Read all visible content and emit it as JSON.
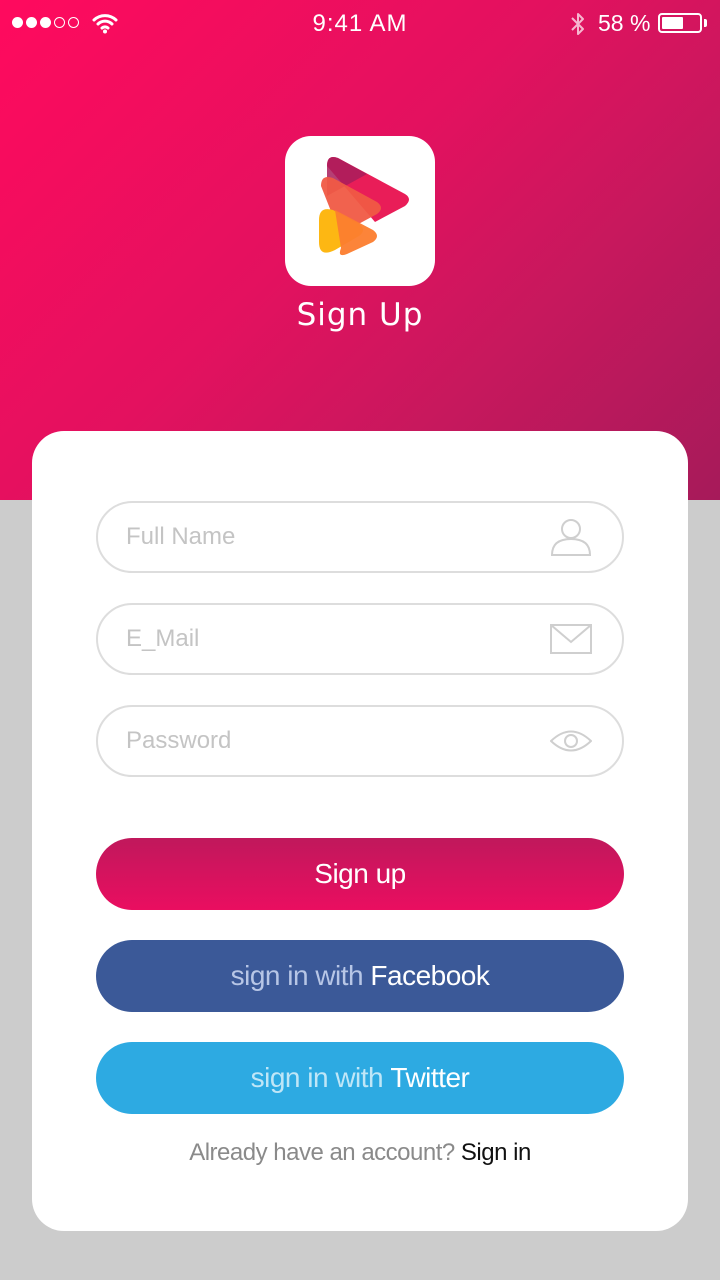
{
  "status_bar": {
    "time": "9:41 AM",
    "battery_percent": "58 %",
    "battery_level": 0.58
  },
  "header": {
    "title": "Sign Up",
    "icons": [
      "app-logo-play-icon"
    ]
  },
  "form": {
    "full_name": {
      "placeholder": "Full Name",
      "value": "",
      "icon": "user-icon"
    },
    "email": {
      "placeholder": "E_Mail",
      "value": "",
      "icon": "mail-icon"
    },
    "password": {
      "placeholder": "Password",
      "value": "",
      "icon": "eye-icon"
    }
  },
  "buttons": {
    "signup_label": "Sign up",
    "facebook_prefix": "sign in with ",
    "facebook_brand": "Facebook",
    "twitter_prefix": "sign in with ",
    "twitter_brand": "Twitter"
  },
  "footer": {
    "prompt": "Already have an account? ",
    "link": "Sign in"
  },
  "colors": {
    "accent": "#e80e60",
    "facebook": "#3b5998",
    "twitter": "#2daae2",
    "background": "#cccccc"
  }
}
